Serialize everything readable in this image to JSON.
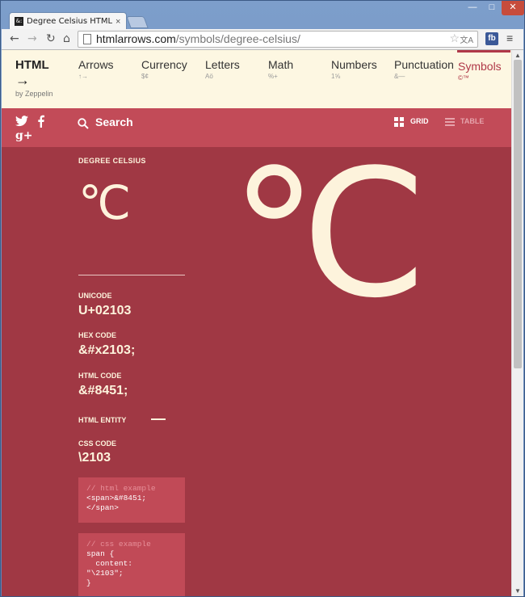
{
  "browser": {
    "tab_title": "Degree Celsius HTML Sy",
    "tab_close": "×",
    "favicon_text": "&:",
    "url_host": "htmlarrows.com",
    "url_path": "/symbols/degree-celsius/",
    "min": "—",
    "max": "□",
    "close": "✕",
    "back": "←",
    "forward": "→",
    "reload": "↻",
    "home": "⌂",
    "star": "☆",
    "translate": "文A",
    "fb": "fb",
    "menu": "≡"
  },
  "site": {
    "logo_title": "HTML",
    "logo_arrow": "→",
    "logo_by": "by Zeppelin",
    "nav": [
      {
        "label": "Arrows",
        "sample": "↑→"
      },
      {
        "label": "Currency",
        "sample": "$¢"
      },
      {
        "label": "Letters",
        "sample": "Aö"
      },
      {
        "label": "Math",
        "sample": "%+"
      },
      {
        "label": "Numbers",
        "sample": "1⅝"
      },
      {
        "label": "Punctuation",
        "sample": "&—"
      },
      {
        "label": "Symbols",
        "sample": "©™"
      }
    ],
    "active_nav": "Symbols"
  },
  "searchbar": {
    "search_label": "Search",
    "grid_label": "GRID",
    "table_label": "TABLE",
    "twitter": "t",
    "facebook": "f",
    "gplus": "g+"
  },
  "symbol": {
    "title": "DEGREE CELSIUS",
    "glyph": "℃",
    "unicode_label": "UNICODE",
    "unicode_value": "U+02103",
    "hex_label": "HEX CODE",
    "hex_value": "&#x2103;",
    "html_label": "HTML CODE",
    "html_value": "&#8451;",
    "entity_label": "HTML ENTITY",
    "css_label": "CSS CODE",
    "css_value": "\\2103",
    "html_example_comment": "// html example",
    "html_example_code": "<span>&#8451;\n</span>",
    "css_example_comment": "// css example",
    "css_example_code": "span {\n  content:\n\"\\2103\";\n}"
  },
  "colors": {
    "nav_bg": "#fdf7e2",
    "search_bg": "#c24b58",
    "content_bg": "#a03844",
    "accent": "#b03848",
    "glyph": "#fdf3dc"
  }
}
